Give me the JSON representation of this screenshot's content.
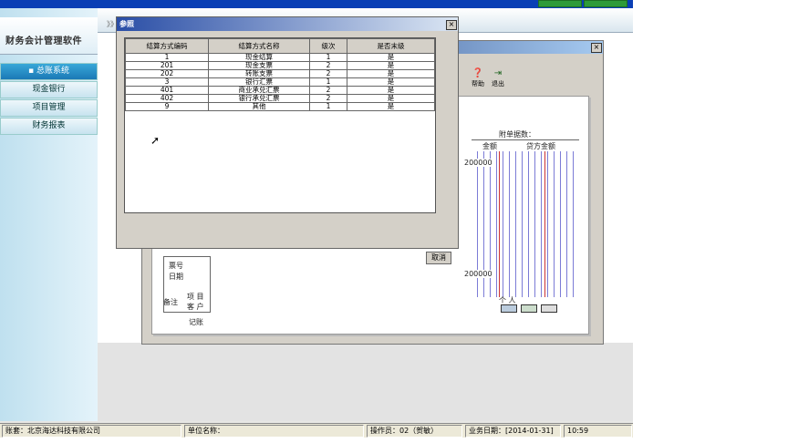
{
  "app": {
    "logo_text": "财务会计管理软件",
    "breadcrumb_glyph": "》》"
  },
  "sidebar": {
    "items": [
      {
        "label": "总账系统",
        "active": true
      },
      {
        "label": "现金银行",
        "active": false
      },
      {
        "label": "项目管理",
        "active": false
      },
      {
        "label": "财务报表",
        "active": false
      }
    ]
  },
  "back_window": {
    "tools": [
      {
        "label": "帮助",
        "icon": "question-icon"
      },
      {
        "label": "退出",
        "icon": "exit-icon"
      }
    ],
    "attach_label": "附单据数：",
    "debit_header": "金额",
    "credit_header": "贷方金额",
    "amount1": "200000",
    "amount2": "200000",
    "row_label_1": "票号",
    "row_label_2": "日期",
    "note_label": "备注",
    "item_label": "项  目",
    "customer_label": "客  户",
    "bookkeep_label": "记账",
    "person_label": "个  人",
    "cancel_label": "取消"
  },
  "dialog": {
    "title": "参照",
    "columns": [
      "结算方式编码",
      "结算方式名称",
      "级次",
      "是否末级"
    ],
    "rows": [
      [
        "1",
        "现金结算",
        "1",
        "是"
      ],
      [
        "201",
        "现金支票",
        "2",
        "是"
      ],
      [
        "202",
        "转账支票",
        "2",
        "是"
      ],
      [
        "3",
        "银行汇票",
        "1",
        "是"
      ],
      [
        "401",
        "商业承兑汇票",
        "2",
        "是"
      ],
      [
        "402",
        "银行承兑汇票",
        "2",
        "是"
      ],
      [
        "9",
        "其他",
        "1",
        "是"
      ]
    ]
  },
  "statusbar": {
    "account": "账套：北京海达科技有限公司",
    "unit": "单位名称：",
    "operator": "操作员：02（贺敏）",
    "date": "业务日期：[2014-01-31]",
    "time": "10:59"
  },
  "colors": {
    "accent": "#1b79b6",
    "title": "#0a246a"
  }
}
